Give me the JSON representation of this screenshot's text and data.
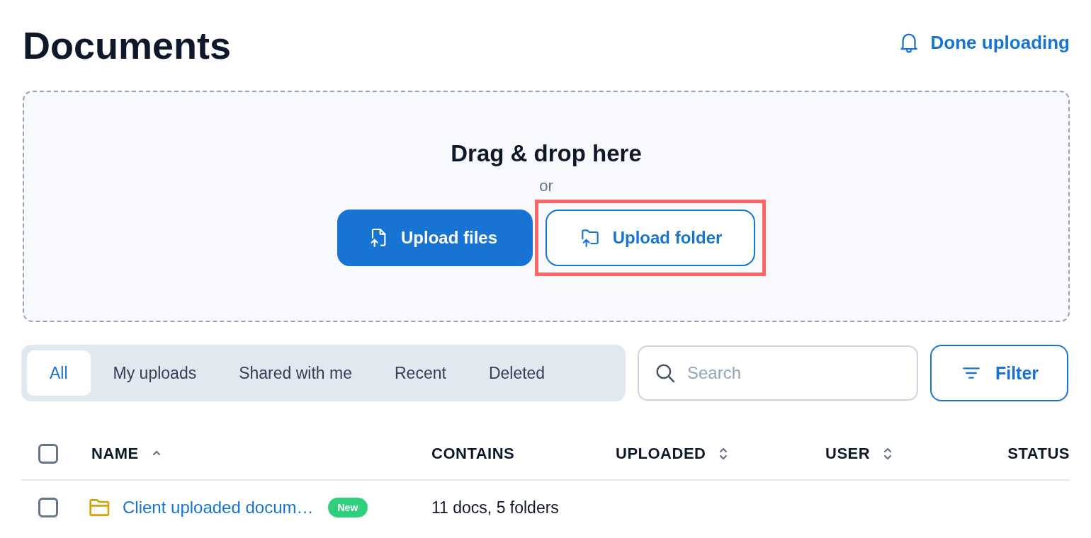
{
  "title": "Documents",
  "notice_link": {
    "label": "Done uploading"
  },
  "dropzone": {
    "heading": "Drag & drop here",
    "separator": "or",
    "buttons": [
      {
        "label": "Upload files",
        "kind": "primary",
        "highlighted": false
      },
      {
        "label": "Upload folder",
        "kind": "secondary",
        "highlighted": true
      }
    ]
  },
  "tabs": [
    {
      "label": "All",
      "selected": true
    },
    {
      "label": "My uploads",
      "selected": false
    },
    {
      "label": "Shared with me",
      "selected": false
    },
    {
      "label": "Recent",
      "selected": false
    },
    {
      "label": "Deleted",
      "selected": false
    }
  ],
  "search": {
    "placeholder": "Search"
  },
  "filter_button": {
    "label": "Filter"
  },
  "table": {
    "select_all": {
      "checked": false
    },
    "columns": [
      {
        "label": "NAME",
        "sortable": true,
        "sorted": true
      },
      {
        "label": "CONTAINS",
        "sortable": false
      },
      {
        "label": "UPLOADED",
        "sortable": true,
        "sorted": false
      },
      {
        "label": "USER",
        "sortable": true,
        "sorted": false
      },
      {
        "label": "STATUS",
        "sortable": false
      }
    ],
    "rows": [
      {
        "checked": false,
        "name": "Client uploaded docum…",
        "badge": "New",
        "contains": "11 docs, 5 folders"
      }
    ]
  }
}
